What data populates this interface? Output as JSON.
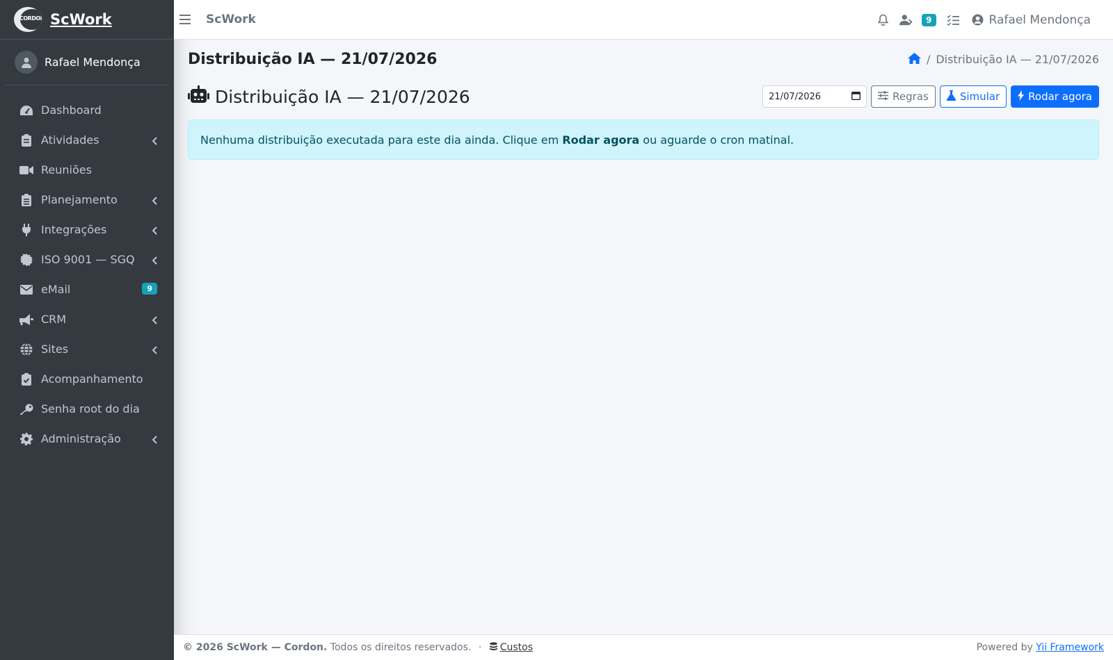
{
  "brand": {
    "logo_text": "CORDON",
    "name": "ScWork"
  },
  "user": {
    "name": "Rafael Mendonça"
  },
  "sidebar": {
    "items": [
      {
        "label": "Dashboard",
        "icon": "dashboard-icon",
        "has_submenu": false
      },
      {
        "label": "Atividades",
        "icon": "clipboard-icon",
        "has_submenu": true
      },
      {
        "label": "Reuniões",
        "icon": "video-icon",
        "has_submenu": false
      },
      {
        "label": "Planejamento",
        "icon": "clipboard-list-icon",
        "has_submenu": true
      },
      {
        "label": "Integrações",
        "icon": "plug-icon",
        "has_submenu": true
      },
      {
        "label": "ISO 9001 — SGQ",
        "icon": "certificate-icon",
        "has_submenu": true
      },
      {
        "label": "eMail",
        "icon": "envelope-icon",
        "has_submenu": true,
        "badge": "9"
      },
      {
        "label": "CRM",
        "icon": "bullhorn-icon",
        "has_submenu": true
      },
      {
        "label": "Sites",
        "icon": "globe-icon",
        "has_submenu": true
      },
      {
        "label": "Acompanhamento",
        "icon": "clipboard-check-icon",
        "has_submenu": false
      },
      {
        "label": "Senha root do dia",
        "icon": "key-icon",
        "has_submenu": false
      },
      {
        "label": "Administração",
        "icon": "gear-icon",
        "has_submenu": true
      }
    ]
  },
  "topbar": {
    "brand": "ScWork",
    "users_badge": "9",
    "user_name": "Rafael Mendonça"
  },
  "page": {
    "title": "Distribuição IA — 21/07/2026",
    "breadcrumb_current": "Distribuição IA — 21/07/2026",
    "heading": "Distribuição IA — 21/07/2026",
    "date_value": "21/07/2026",
    "buttons": {
      "rules": "Regras",
      "simulate": "Simular",
      "run_now": "Rodar agora"
    },
    "alert": {
      "before": "Nenhuma distribuição executada para este dia ainda. Clique em ",
      "bold": "Rodar agora",
      "after": " ou aguarde o cron matinal."
    }
  },
  "footer": {
    "copyright": "© 2026 ScWork — Cordon.",
    "rights": "Todos os direitos reservados.",
    "dot": "·",
    "costs": "Custos",
    "powered_by": "Powered by",
    "framework": "Yii Framework"
  },
  "colors": {
    "sidebar_bg": "#343a40",
    "primary": "#0d6efd",
    "info": "#17a2b8",
    "alert_bg": "#cff4fc"
  }
}
